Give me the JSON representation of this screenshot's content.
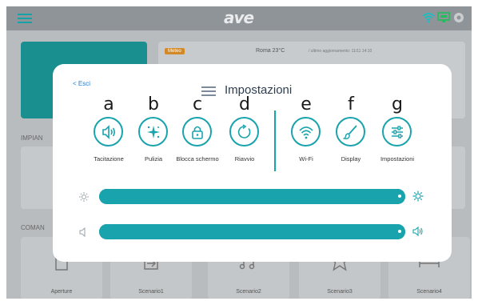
{
  "app": {
    "logo": "ave"
  },
  "background": {
    "weather": {
      "badge": "Meteo",
      "city_temp": "Roma 23°C",
      "updated": "/ ultimo aggiornamento: 11/11 14:10"
    },
    "section_impianti": "IMPIAN",
    "section_comandi": "COMAN",
    "scenes": [
      {
        "label": "Aperture",
        "icon": "door-icon"
      },
      {
        "label": "Scenario1",
        "icon": "home-arrow-icon"
      },
      {
        "label": "Scenario2",
        "icon": "music-note-icon"
      },
      {
        "label": "Scenario3",
        "icon": "star-icon"
      },
      {
        "label": "Scenario4",
        "icon": "bed-icon"
      }
    ]
  },
  "modal": {
    "back": "< Esci",
    "title": "Impostazioni",
    "items": [
      {
        "letter": "a",
        "label": "Tacitazione",
        "icon": "speaker-icon"
      },
      {
        "letter": "b",
        "label": "Pulizia",
        "icon": "sparkle-icon"
      },
      {
        "letter": "c",
        "label": "Blocca schermo",
        "icon": "lock-icon"
      },
      {
        "letter": "d",
        "label": "Riavvio",
        "icon": "restart-icon"
      },
      {
        "letter": "e",
        "label": "Wi-Fi",
        "icon": "wifi-icon"
      },
      {
        "letter": "f",
        "label": "Display",
        "icon": "brush-icon"
      },
      {
        "letter": "g",
        "label": "Impostazioni",
        "icon": "sliders-icon"
      }
    ],
    "brightness": {
      "level_pct": 100
    },
    "volume": {
      "level_pct": 100
    }
  },
  "colors": {
    "accent": "#19a3ad",
    "overlay": "#b9bcbf",
    "teal_card": "#198f8f"
  }
}
